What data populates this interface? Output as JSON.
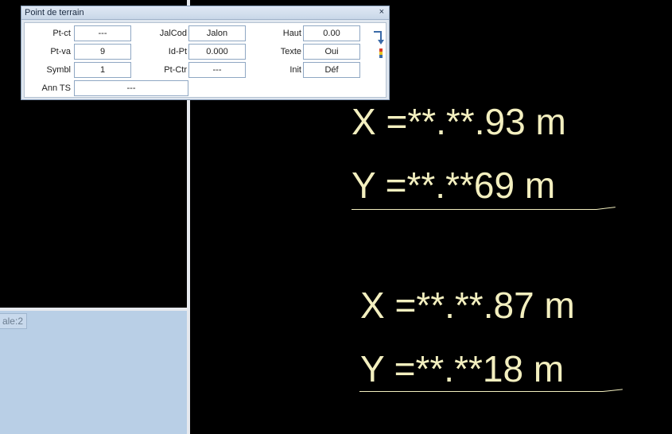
{
  "dialog": {
    "title": "Point de terrain",
    "close_glyph": "×",
    "fields": {
      "pt_ct": {
        "label": "Pt-ct",
        "value": "---"
      },
      "pt_va": {
        "label": "Pt-va",
        "value": "9"
      },
      "symbl": {
        "label": "Symbl",
        "value": "1"
      },
      "ann_ts": {
        "label": "Ann TS",
        "value": "---"
      },
      "jalcod": {
        "label": "JalCod",
        "value": "Jalon"
      },
      "id_pt": {
        "label": "Id-Pt",
        "value": "0.000"
      },
      "pt_ctr": {
        "label": "Pt-Ctr",
        "value": "---"
      },
      "haut": {
        "label": "Haut",
        "value": "0.00"
      },
      "texte": {
        "label": "Texte",
        "value": "Oui"
      },
      "init": {
        "label": "Init",
        "value": "Déf"
      }
    },
    "pin_icon": "pin-arrow-icon"
  },
  "layout_tab": {
    "label": "ale:2"
  },
  "drawing": {
    "labels": [
      "X =**.**.93 m",
      "Y =**.**69 m",
      "X =**.**.87 m",
      "Y =**.**18 m"
    ],
    "text_color": "#f3efbf",
    "background": "#000000"
  },
  "colors": {
    "dialog_bg": "#dfe6ef",
    "field_border": "#8fa7c3",
    "lower_pane": "#b9cfe6"
  }
}
